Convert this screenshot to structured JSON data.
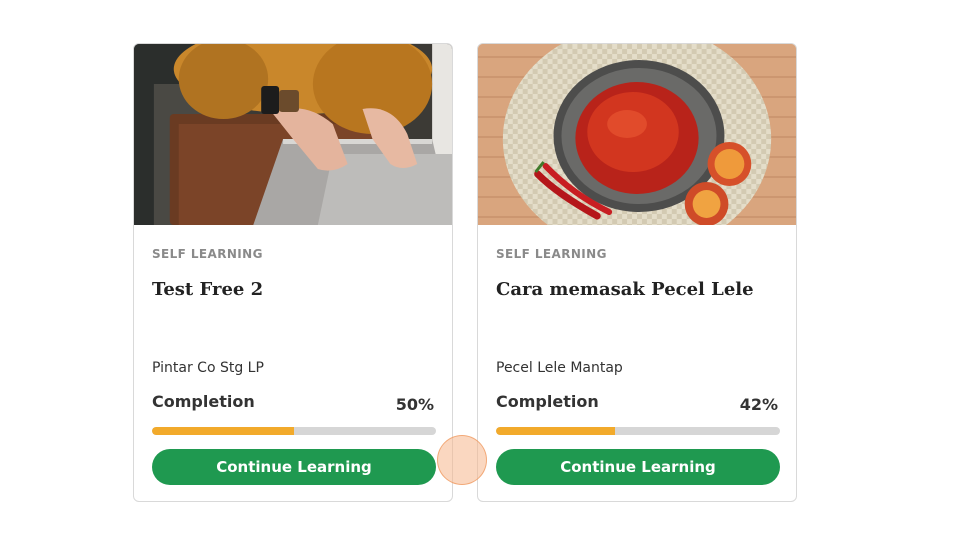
{
  "courses": [
    {
      "category": "SELF LEARNING",
      "title": "Test Free 2",
      "provider": "Pintar Co Stg LP",
      "completion_label": "Completion",
      "completion_text": "50%",
      "progress": 0.5,
      "cta_label": "Continue Learning",
      "image_icon": "laptop-photo"
    },
    {
      "category": "SELF LEARNING",
      "title": "Cara memasak Pecel Lele",
      "provider": "Pecel Lele Mantap",
      "completion_label": "Completion",
      "completion_text": "42%",
      "progress": 0.42,
      "cta_label": "Continue Learning",
      "image_icon": "sambal-bowl-photo"
    }
  ],
  "colors": {
    "accent_green": "#1f9950",
    "progress_fill": "#f2aa2b",
    "progress_track": "#d6d6d6"
  }
}
